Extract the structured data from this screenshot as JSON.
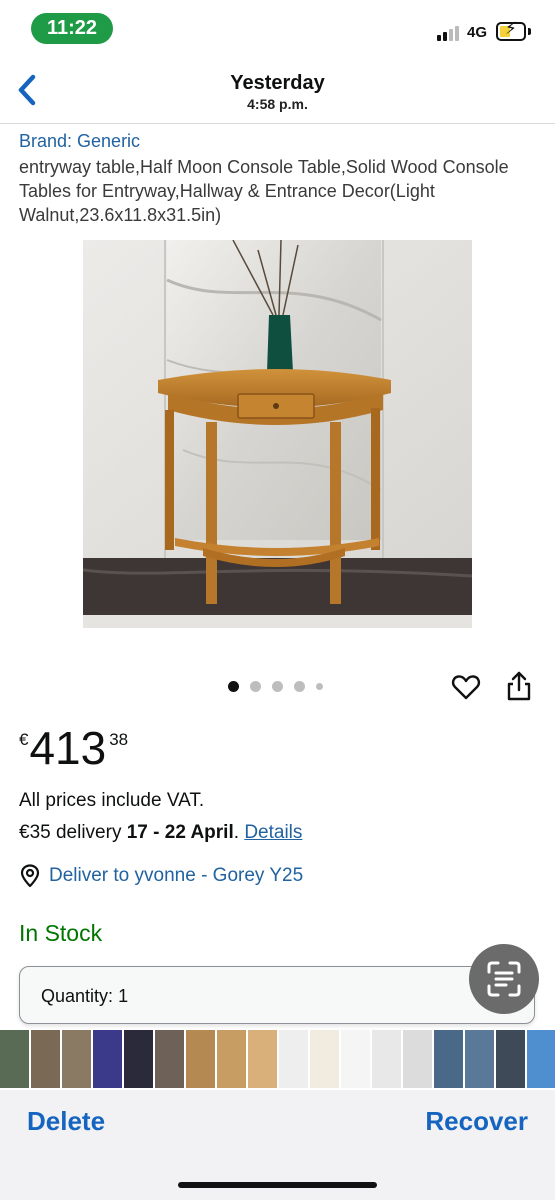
{
  "status_bar": {
    "time": "11:22",
    "network": "4G",
    "colors": {
      "time_pill": "#1f9a46",
      "battery_charge": "#f5d23c"
    }
  },
  "header": {
    "title": "Yesterday",
    "subtitle": "4:58 p.m.",
    "back_icon": "chevron-left-icon"
  },
  "product": {
    "brand": "Brand: Generic",
    "title": "entryway table,Half Moon Console Table,Solid Wood Console Tables for Entryway,Hallway & Entrance Decor(Light Walnut,23.6x11.8x31.5in)",
    "image_count": 5,
    "active_image_index": 0
  },
  "actions": {
    "favorite_icon": "heart-outline-icon",
    "share_icon": "share-icon"
  },
  "price": {
    "currency": "€",
    "whole": "413",
    "fraction": "38"
  },
  "vat_text": "All prices include VAT.",
  "delivery": {
    "prefix": "€35 delivery ",
    "dates": "17 - 22 April",
    "suffix": ". ",
    "details_link": "Details"
  },
  "deliver_to": {
    "icon": "location-pin-icon",
    "text": "Deliver to yvonne - Gorey Y25"
  },
  "stock_status": "In Stock",
  "quantity": {
    "label": "Quantity:",
    "value": "1"
  },
  "overlay": {
    "scan_icon": "text-scan-icon"
  },
  "bottom_bar": {
    "delete_label": "Delete",
    "recover_label": "Recover",
    "accent_color": "#1565c0"
  },
  "colors": {
    "link": "#2162a1",
    "in_stock": "#007600"
  }
}
